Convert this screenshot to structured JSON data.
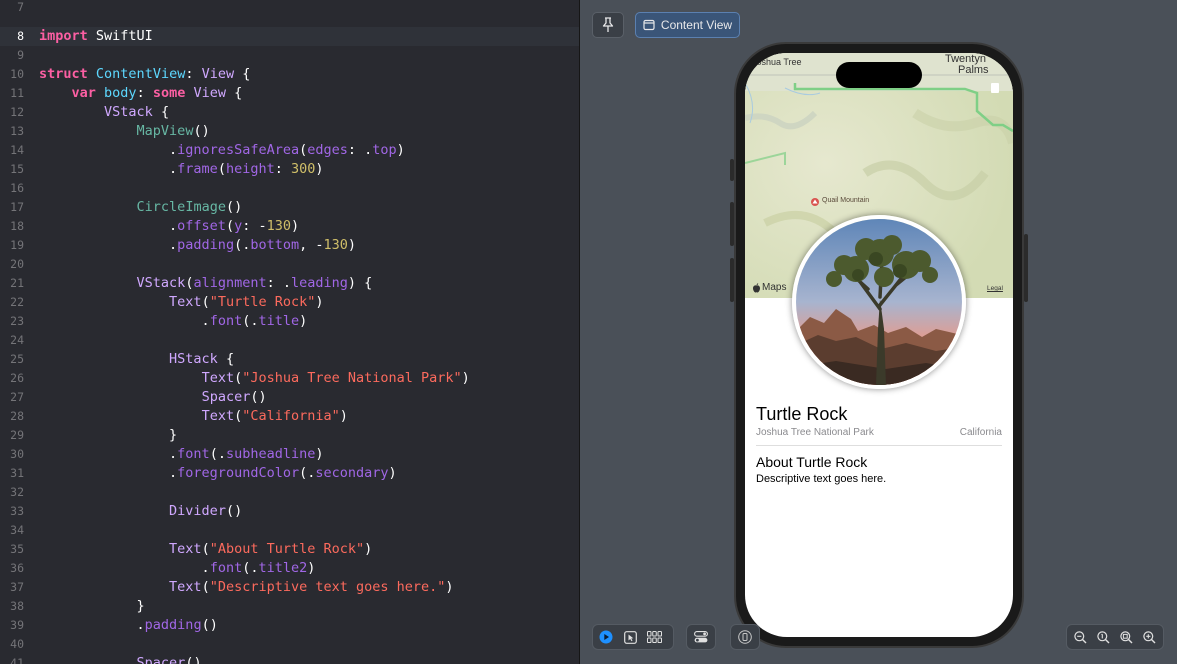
{
  "editor": {
    "lines": [
      {
        "n": "7",
        "tokens": []
      },
      {
        "n": "8",
        "current": true,
        "tokens": [
          {
            "t": "import",
            "c": "kw"
          },
          {
            "t": " SwiftUI",
            "c": "pl"
          }
        ]
      },
      {
        "n": "9",
        "tokens": []
      },
      {
        "n": "10",
        "tokens": [
          {
            "t": "struct",
            "c": "kw"
          },
          {
            "t": " ",
            "c": "pl"
          },
          {
            "t": "ContentView",
            "c": "typ"
          },
          {
            "t": ": ",
            "c": "pl"
          },
          {
            "t": "View",
            "c": "ty2"
          },
          {
            "t": " {",
            "c": "pl"
          }
        ]
      },
      {
        "n": "11",
        "tokens": [
          {
            "t": "    ",
            "c": "pl"
          },
          {
            "t": "var",
            "c": "kw"
          },
          {
            "t": " ",
            "c": "pl"
          },
          {
            "t": "body",
            "c": "typ"
          },
          {
            "t": ": ",
            "c": "pl"
          },
          {
            "t": "some",
            "c": "kw"
          },
          {
            "t": " ",
            "c": "pl"
          },
          {
            "t": "View",
            "c": "ty2"
          },
          {
            "t": " {",
            "c": "pl"
          }
        ]
      },
      {
        "n": "12",
        "tokens": [
          {
            "t": "        ",
            "c": "pl"
          },
          {
            "t": "VStack",
            "c": "ty2"
          },
          {
            "t": " {",
            "c": "pl"
          }
        ]
      },
      {
        "n": "13",
        "tokens": [
          {
            "t": "            ",
            "c": "pl"
          },
          {
            "t": "MapView",
            "c": "fn"
          },
          {
            "t": "()",
            "c": "pl"
          }
        ]
      },
      {
        "n": "14",
        "tokens": [
          {
            "t": "                .",
            "c": "pl"
          },
          {
            "t": "ignoresSafeArea",
            "c": "mt"
          },
          {
            "t": "(",
            "c": "pl"
          },
          {
            "t": "edges",
            "c": "mt"
          },
          {
            "t": ": .",
            "c": "pl"
          },
          {
            "t": "top",
            "c": "mt"
          },
          {
            "t": ")",
            "c": "pl"
          }
        ]
      },
      {
        "n": "15",
        "tokens": [
          {
            "t": "                .",
            "c": "pl"
          },
          {
            "t": "frame",
            "c": "mt"
          },
          {
            "t": "(",
            "c": "pl"
          },
          {
            "t": "height",
            "c": "mt"
          },
          {
            "t": ": ",
            "c": "pl"
          },
          {
            "t": "300",
            "c": "num"
          },
          {
            "t": ")",
            "c": "pl"
          }
        ]
      },
      {
        "n": "16",
        "tokens": []
      },
      {
        "n": "17",
        "tokens": [
          {
            "t": "            ",
            "c": "pl"
          },
          {
            "t": "CircleImage",
            "c": "fn"
          },
          {
            "t": "()",
            "c": "pl"
          }
        ]
      },
      {
        "n": "18",
        "tokens": [
          {
            "t": "                .",
            "c": "pl"
          },
          {
            "t": "offset",
            "c": "mt"
          },
          {
            "t": "(",
            "c": "pl"
          },
          {
            "t": "y",
            "c": "mt"
          },
          {
            "t": ": -",
            "c": "pl"
          },
          {
            "t": "130",
            "c": "num"
          },
          {
            "t": ")",
            "c": "pl"
          }
        ]
      },
      {
        "n": "19",
        "tokens": [
          {
            "t": "                .",
            "c": "pl"
          },
          {
            "t": "padding",
            "c": "mt"
          },
          {
            "t": "(.",
            "c": "pl"
          },
          {
            "t": "bottom",
            "c": "mt"
          },
          {
            "t": ", -",
            "c": "pl"
          },
          {
            "t": "130",
            "c": "num"
          },
          {
            "t": ")",
            "c": "pl"
          }
        ]
      },
      {
        "n": "20",
        "tokens": []
      },
      {
        "n": "21",
        "tokens": [
          {
            "t": "            ",
            "c": "pl"
          },
          {
            "t": "VStack",
            "c": "ty2"
          },
          {
            "t": "(",
            "c": "pl"
          },
          {
            "t": "alignment",
            "c": "mt"
          },
          {
            "t": ": .",
            "c": "pl"
          },
          {
            "t": "leading",
            "c": "mt"
          },
          {
            "t": ") {",
            "c": "pl"
          }
        ]
      },
      {
        "n": "22",
        "tokens": [
          {
            "t": "                ",
            "c": "pl"
          },
          {
            "t": "Text",
            "c": "ty2"
          },
          {
            "t": "(",
            "c": "pl"
          },
          {
            "t": "\"Turtle Rock\"",
            "c": "str"
          },
          {
            "t": ")",
            "c": "pl"
          }
        ]
      },
      {
        "n": "23",
        "tokens": [
          {
            "t": "                    .",
            "c": "pl"
          },
          {
            "t": "font",
            "c": "mt"
          },
          {
            "t": "(.",
            "c": "pl"
          },
          {
            "t": "title",
            "c": "mt"
          },
          {
            "t": ")",
            "c": "pl"
          }
        ]
      },
      {
        "n": "24",
        "tokens": []
      },
      {
        "n": "25",
        "tokens": [
          {
            "t": "                ",
            "c": "pl"
          },
          {
            "t": "HStack",
            "c": "ty2"
          },
          {
            "t": " {",
            "c": "pl"
          }
        ]
      },
      {
        "n": "26",
        "tokens": [
          {
            "t": "                    ",
            "c": "pl"
          },
          {
            "t": "Text",
            "c": "ty2"
          },
          {
            "t": "(",
            "c": "pl"
          },
          {
            "t": "\"Joshua Tree National Park\"",
            "c": "str"
          },
          {
            "t": ")",
            "c": "pl"
          }
        ]
      },
      {
        "n": "27",
        "tokens": [
          {
            "t": "                    ",
            "c": "pl"
          },
          {
            "t": "Spacer",
            "c": "ty2"
          },
          {
            "t": "()",
            "c": "pl"
          }
        ]
      },
      {
        "n": "28",
        "tokens": [
          {
            "t": "                    ",
            "c": "pl"
          },
          {
            "t": "Text",
            "c": "ty2"
          },
          {
            "t": "(",
            "c": "pl"
          },
          {
            "t": "\"California\"",
            "c": "str"
          },
          {
            "t": ")",
            "c": "pl"
          }
        ]
      },
      {
        "n": "29",
        "tokens": [
          {
            "t": "                }",
            "c": "pl"
          }
        ]
      },
      {
        "n": "30",
        "tokens": [
          {
            "t": "                .",
            "c": "pl"
          },
          {
            "t": "font",
            "c": "mt"
          },
          {
            "t": "(.",
            "c": "pl"
          },
          {
            "t": "subheadline",
            "c": "mt"
          },
          {
            "t": ")",
            "c": "pl"
          }
        ]
      },
      {
        "n": "31",
        "tokens": [
          {
            "t": "                .",
            "c": "pl"
          },
          {
            "t": "foregroundColor",
            "c": "mt"
          },
          {
            "t": "(.",
            "c": "pl"
          },
          {
            "t": "secondary",
            "c": "mt"
          },
          {
            "t": ")",
            "c": "pl"
          }
        ]
      },
      {
        "n": "32",
        "tokens": []
      },
      {
        "n": "33",
        "tokens": [
          {
            "t": "                ",
            "c": "pl"
          },
          {
            "t": "Divider",
            "c": "ty2"
          },
          {
            "t": "()",
            "c": "pl"
          }
        ]
      },
      {
        "n": "34",
        "tokens": []
      },
      {
        "n": "35",
        "tokens": [
          {
            "t": "                ",
            "c": "pl"
          },
          {
            "t": "Text",
            "c": "ty2"
          },
          {
            "t": "(",
            "c": "pl"
          },
          {
            "t": "\"About Turtle Rock\"",
            "c": "str"
          },
          {
            "t": ")",
            "c": "pl"
          }
        ]
      },
      {
        "n": "36",
        "tokens": [
          {
            "t": "                    .",
            "c": "pl"
          },
          {
            "t": "font",
            "c": "mt"
          },
          {
            "t": "(.",
            "c": "pl"
          },
          {
            "t": "title2",
            "c": "mt"
          },
          {
            "t": ")",
            "c": "pl"
          }
        ]
      },
      {
        "n": "37",
        "tokens": [
          {
            "t": "                ",
            "c": "pl"
          },
          {
            "t": "Text",
            "c": "ty2"
          },
          {
            "t": "(",
            "c": "pl"
          },
          {
            "t": "\"Descriptive text goes here.\"",
            "c": "str"
          },
          {
            "t": ")",
            "c": "pl"
          }
        ]
      },
      {
        "n": "38",
        "tokens": [
          {
            "t": "            }",
            "c": "pl"
          }
        ]
      },
      {
        "n": "39",
        "tokens": [
          {
            "t": "            .",
            "c": "pl"
          },
          {
            "t": "padding",
            "c": "mt"
          },
          {
            "t": "()",
            "c": "pl"
          }
        ]
      },
      {
        "n": "40",
        "tokens": []
      },
      {
        "n": "41",
        "tokens": [
          {
            "t": "            ",
            "c": "pl"
          },
          {
            "t": "Spacer",
            "c": "ty2"
          },
          {
            "t": "()",
            "c": "pl"
          }
        ]
      }
    ]
  },
  "canvas": {
    "toolbar": {
      "pin_icon": "pin-icon",
      "content_view_label": "Content View"
    },
    "map": {
      "label_joshua_tree": "Joshua Tree",
      "label_twentynine_1": "Twentyn",
      "label_twentynine_2": "Palms",
      "poi_label": "Quail Mountain",
      "brand_label": "Maps",
      "legal_label": "Legal"
    },
    "preview": {
      "title": "Turtle Rock",
      "park": "Joshua Tree National Park",
      "state": "California",
      "about": "About Turtle Rock",
      "description": "Descriptive text goes here."
    },
    "bottom_left_icons": [
      "live-preview-icon",
      "selectable-icon",
      "variants-icon"
    ],
    "device_settings_icon": "device-settings-icon",
    "orientation_icon": "orientation-icon",
    "zoom_icons": [
      "zoom-out-icon",
      "zoom-actual-icon",
      "zoom-fit-icon",
      "zoom-in-icon"
    ]
  }
}
